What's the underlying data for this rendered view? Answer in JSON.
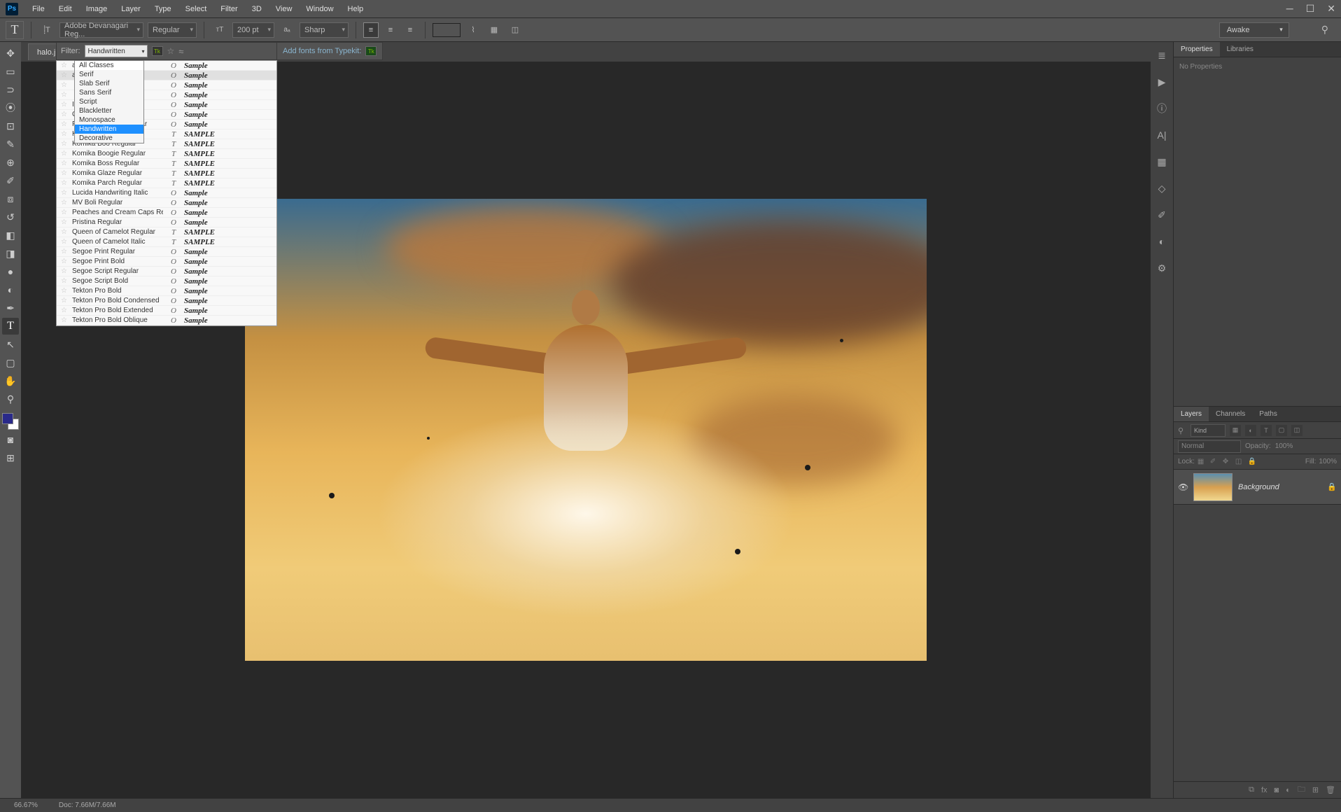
{
  "app": {
    "logo": "Ps"
  },
  "menu": [
    "File",
    "Edit",
    "Image",
    "Layer",
    "Type",
    "Select",
    "Filter",
    "3D",
    "View",
    "Window",
    "Help"
  ],
  "options": {
    "font_family": "Adobe Devanagari Reg...",
    "font_style": "Regular",
    "font_size": "200 pt",
    "anti_alias": "Sharp",
    "color": "#2a2a9a",
    "workspace": "Awake"
  },
  "document": {
    "tab": "halo.jpg @",
    "zoom": "66.67%",
    "doc_size": "Doc: 7.66M/7.66M"
  },
  "font_filter": {
    "label": "Filter:",
    "value": "Handwritten",
    "typekit_text": "Add fonts from Typekit:"
  },
  "filter_classes": [
    "All Classes",
    "Serif",
    "Slab Serif",
    "Sans Serif",
    "Script",
    "Blackletter",
    "Monospace",
    "Handwritten",
    "Decorative"
  ],
  "filter_selected": "Handwritten",
  "fonts": [
    {
      "name": "ar",
      "type": "O",
      "sample": "Sample"
    },
    {
      "name": "ar",
      "type": "O",
      "sample": "Sample",
      "hover": true
    },
    {
      "name": "",
      "type": "O",
      "sample": "Sample"
    },
    {
      "name": "",
      "type": "O",
      "sample": "Sample"
    },
    {
      "name": "Italic",
      "type": "O",
      "sample": "Sample"
    },
    {
      "name": "Comic Sans MS Italic",
      "type": "O",
      "sample": "Sample"
    },
    {
      "name": "Freestyle Script Regular",
      "type": "O",
      "sample": "Sample"
    },
    {
      "name": "Komika Axis Regular",
      "type": "T",
      "sample": "SAMPLE"
    },
    {
      "name": "Komika Boo Regular",
      "type": "T",
      "sample": "SAMPLE"
    },
    {
      "name": "Komika Boogie Regular",
      "type": "T",
      "sample": "SAMPLE"
    },
    {
      "name": "Komika Boss Regular",
      "type": "T",
      "sample": "SAMPLE"
    },
    {
      "name": "Komika Glaze Regular",
      "type": "T",
      "sample": "SAMPLE"
    },
    {
      "name": "Komika Parch Regular",
      "type": "T",
      "sample": "SAMPLE"
    },
    {
      "name": "Lucida Handwriting Italic",
      "type": "O",
      "sample": "Sample"
    },
    {
      "name": "MV Boli Regular",
      "type": "O",
      "sample": "Sample"
    },
    {
      "name": "Peaches and Cream Caps Regular",
      "type": "O",
      "sample": "Sample"
    },
    {
      "name": "Pristina Regular",
      "type": "O",
      "sample": "Sample"
    },
    {
      "name": "Queen of Camelot Regular",
      "type": "T",
      "sample": "SAMPLE"
    },
    {
      "name": "Queen of Camelot Italic",
      "type": "T",
      "sample": "SAMPLE"
    },
    {
      "name": "Segoe Print Regular",
      "type": "O",
      "sample": "Sample"
    },
    {
      "name": "Segoe Print Bold",
      "type": "O",
      "sample": "Sample"
    },
    {
      "name": "Segoe Script Regular",
      "type": "O",
      "sample": "Sample"
    },
    {
      "name": "Segoe Script Bold",
      "type": "O",
      "sample": "Sample"
    },
    {
      "name": "Tekton Pro Bold",
      "type": "O",
      "sample": "Sample"
    },
    {
      "name": "Tekton Pro Bold Condensed",
      "type": "O",
      "sample": "Sample"
    },
    {
      "name": "Tekton Pro Bold Extended",
      "type": "O",
      "sample": "Sample"
    },
    {
      "name": "Tekton Pro Bold Oblique",
      "type": "O",
      "sample": "Sample"
    }
  ],
  "properties_panel": {
    "tabs": [
      "Properties",
      "Libraries"
    ],
    "body": "No Properties"
  },
  "layers_panel": {
    "tabs": [
      "Layers",
      "Channels",
      "Paths"
    ],
    "kind": "Kind",
    "blend": "Normal",
    "opacity_label": "Opacity:",
    "opacity": "100%",
    "lock_label": "Lock:",
    "fill_label": "Fill:",
    "fill": "100%",
    "layer_name": "Background"
  }
}
